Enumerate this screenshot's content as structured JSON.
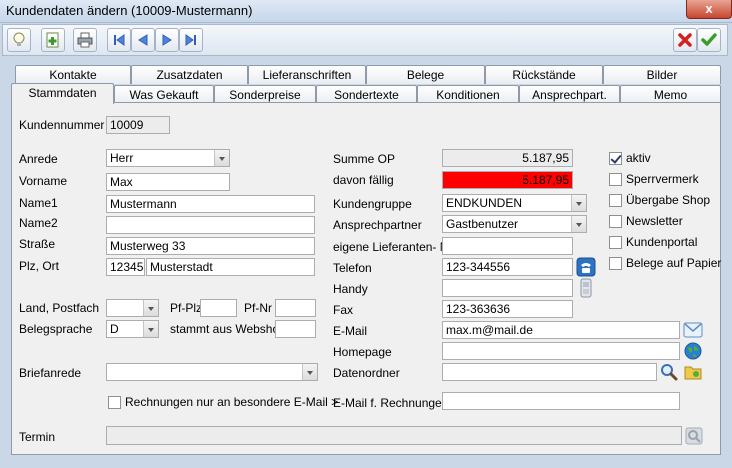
{
  "window": {
    "title": "Kundendaten ändern (10009-Mustermann)",
    "close": "x"
  },
  "toolbar": {
    "icons": [
      "lightbulb-icon",
      "add-document-icon",
      "print-icon",
      "first-record-icon",
      "previous-record-icon",
      "next-record-icon",
      "last-record-icon",
      "cancel-icon",
      "confirm-icon"
    ]
  },
  "tabs_back": [
    "Kontakte",
    "Zusatzdaten",
    "Lieferanschriften",
    "Belege",
    "Rückstände",
    "Bilder"
  ],
  "tabs_front": [
    "Stammdaten",
    "Was Gekauft",
    "Sonderpreise",
    "Sondertexte",
    "Konditionen",
    "Ansprechpart.",
    "Memo"
  ],
  "form": {
    "kundennummer": {
      "label": "Kundennummer",
      "value": "10009"
    },
    "anrede": {
      "label": "Anrede",
      "value": "Herr"
    },
    "vorname": {
      "label": "Vorname",
      "value": "Max"
    },
    "name1": {
      "label": "Name1",
      "value": "Mustermann"
    },
    "name2": {
      "label": "Name2",
      "value": ""
    },
    "strasse": {
      "label": "Straße",
      "value": "Musterweg 33"
    },
    "plzort": {
      "label": "Plz, Ort",
      "plz": "12345",
      "ort": "Musterstadt"
    },
    "land": {
      "label": "Land, Postfach",
      "value": ""
    },
    "pfplz": {
      "label": "Pf-Plz",
      "value": ""
    },
    "pfnr": {
      "label": "Pf-Nr",
      "value": ""
    },
    "belegsprache": {
      "label": "Belegsprache",
      "value": "D"
    },
    "webshop": {
      "label": "stammt aus Webshop",
      "value": ""
    },
    "briefanrede": {
      "label": "Briefanrede",
      "value": ""
    },
    "rechnungen_email": {
      "label": "Rechnungen nur an besondere E-Mail >",
      "checked": false
    },
    "termin": {
      "label": "Termin",
      "value": ""
    },
    "summe_op": {
      "label": "Summe OP",
      "value": "5.187,95"
    },
    "davon_faellig": {
      "label": "davon fällig",
      "value": "5.187,95"
    },
    "kundengruppe": {
      "label": "Kundengruppe",
      "value": "ENDKUNDEN"
    },
    "ansprechpartner": {
      "label": "Ansprechpartner",
      "value": "Gastbenutzer"
    },
    "lieferanten_nr": {
      "label": "eigene Lieferanten- Nr.",
      "value": ""
    },
    "telefon": {
      "label": "Telefon",
      "value": "123-344556"
    },
    "handy": {
      "label": "Handy",
      "value": ""
    },
    "fax": {
      "label": "Fax",
      "value": "123-363636"
    },
    "email": {
      "label": "E-Mail",
      "value": "max.m@mail.de"
    },
    "homepage": {
      "label": "Homepage",
      "value": ""
    },
    "datenordner": {
      "label": "Datenordner",
      "value": ""
    },
    "email_rechnungen": {
      "label": "E-Mail f. Rechnungen",
      "value": ""
    }
  },
  "checks": [
    {
      "label": "aktiv",
      "checked": true
    },
    {
      "label": "Sperrvermerk",
      "checked": false
    },
    {
      "label": "Übergabe Shop",
      "checked": false
    },
    {
      "label": "Newsletter",
      "checked": false
    },
    {
      "label": "Kundenportal",
      "checked": false
    },
    {
      "label": "Belege auf Papier",
      "checked": false
    }
  ],
  "colors": {
    "accent": "#c9d7e6",
    "overdue": "#ff0000"
  }
}
